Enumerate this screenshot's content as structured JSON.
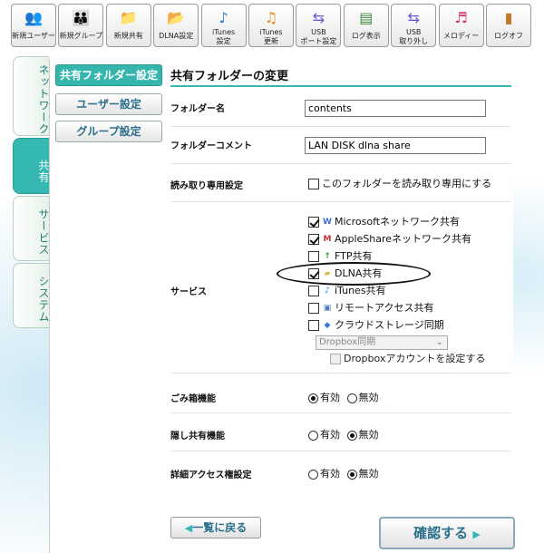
{
  "toolbar": [
    {
      "label": "新規ユーザー",
      "icon": "users-icon",
      "glyph": "👥",
      "color": "#d9822b"
    },
    {
      "label": "新規グループ",
      "icon": "group-icon",
      "glyph": "👪",
      "color": "#d9822b"
    },
    {
      "label": "新規共有",
      "icon": "folder-icon",
      "glyph": "📁",
      "color": "#e0b84a"
    },
    {
      "label": "DLNA設定",
      "icon": "dlna-folder-icon",
      "glyph": "📂",
      "color": "#4a9a4a"
    },
    {
      "label": "iTunes\n設定",
      "icon": "music-note-icon",
      "glyph": "♪",
      "color": "#2a7fd0"
    },
    {
      "label": "iTunes\n更新",
      "icon": "music-refresh-icon",
      "glyph": "♫",
      "color": "#e08a1a"
    },
    {
      "label": "USB\nポート設定",
      "icon": "usb-icon",
      "glyph": "⇆",
      "color": "#6a5acd"
    },
    {
      "label": "ログ表示",
      "icon": "log-icon",
      "glyph": "▤",
      "color": "#3a8a3a"
    },
    {
      "label": "USB\n取り外し",
      "icon": "usb-remove-icon",
      "glyph": "⇆",
      "color": "#6a5acd"
    },
    {
      "label": "メロディー",
      "icon": "melody-icon",
      "glyph": "♬",
      "color": "#d0305a"
    },
    {
      "label": "ログオフ",
      "icon": "logoff-door-icon",
      "glyph": "▮",
      "color": "#c07a2a"
    }
  ],
  "nav": {
    "network": "ネットワーク",
    "share": "共有",
    "service": "サービス",
    "system": "システム"
  },
  "sidebar": {
    "shared_folder": "共有フォルダー設定",
    "user": "ユーザー設定",
    "group": "グループ設定"
  },
  "main": {
    "title": "共有フォルダーの変更",
    "folder_name_label": "フォルダー名",
    "folder_name_value": "contents",
    "folder_comment_label": "フォルダーコメント",
    "folder_comment_value": "LAN DISK dlna share",
    "readonly_label": "読み取り専用設定",
    "readonly_text": "このフォルダーを読み取り専用にする",
    "service_label": "サービス",
    "services": [
      {
        "label": "Microsoftネットワーク共有",
        "checked": true,
        "icon": "microsoft-icon",
        "glyph": "W",
        "color": "#3a6fd0"
      },
      {
        "label": "AppleShareネットワーク共有",
        "checked": true,
        "icon": "appleshare-icon",
        "glyph": "M",
        "color": "#d03030"
      },
      {
        "label": "FTP共有",
        "checked": false,
        "icon": "ftp-icon",
        "glyph": "↑",
        "color": "#3a9a3a"
      },
      {
        "label": "DLNA共有",
        "checked": true,
        "icon": "dlna-icon",
        "glyph": "▰",
        "color": "#e0b84a"
      },
      {
        "label": "iTunes共有",
        "checked": false,
        "icon": "itunes-icon",
        "glyph": "♪",
        "color": "#2a7fd0"
      },
      {
        "label": "リモートアクセス共有",
        "checked": false,
        "icon": "remote-access-icon",
        "glyph": "▣",
        "color": "#4a7ac0"
      },
      {
        "label": "クラウドストレージ同期",
        "checked": false,
        "icon": "cloud-storage-icon",
        "glyph": "◆",
        "color": "#3a7ad0"
      }
    ],
    "dropbox_select": "Dropbox同期",
    "dropbox_account": "Dropboxアカウントを設定する",
    "trash_label": "ごみ箱機能",
    "hidden_label": "隠し共有機能",
    "access_label": "詳細アクセス権設定",
    "enabled": "有効",
    "disabled": "無効",
    "trash_value": "有効",
    "hidden_value": "無効",
    "access_value": "無効"
  },
  "buttons": {
    "back": "一覧に戻る",
    "confirm": "確認する"
  }
}
